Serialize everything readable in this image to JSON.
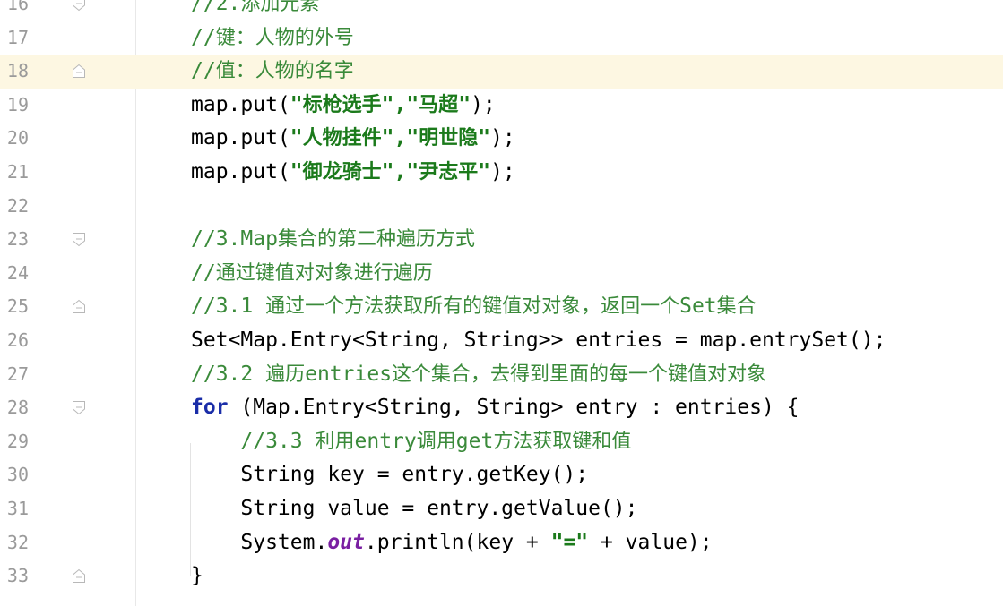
{
  "editor": {
    "current_line": 18,
    "lines": [
      {
        "num": "16",
        "fold": "open",
        "segments": [
          {
            "t": "//2.",
            "c": "cm"
          },
          {
            "t": "添加元素",
            "c": "cm-cn"
          }
        ]
      },
      {
        "num": "17",
        "fold": "none",
        "segments": [
          {
            "t": "//",
            "c": "cm"
          },
          {
            "t": "键：人物的外号",
            "c": "cm-cn"
          }
        ]
      },
      {
        "num": "18",
        "fold": "close",
        "segments": [
          {
            "t": "//",
            "c": "cm"
          },
          {
            "t": "值：人物的名字",
            "c": "cm-cn"
          }
        ]
      },
      {
        "num": "19",
        "fold": "none",
        "segments": [
          {
            "t": "map.put(",
            "c": ""
          },
          {
            "t": "\"",
            "c": "strq"
          },
          {
            "t": "标枪选手",
            "c": "str"
          },
          {
            "t": "\",\"",
            "c": "strq"
          },
          {
            "t": "马超",
            "c": "str"
          },
          {
            "t": "\"",
            "c": "strq"
          },
          {
            "t": ");",
            "c": ""
          }
        ]
      },
      {
        "num": "20",
        "fold": "none",
        "segments": [
          {
            "t": "map.put(",
            "c": ""
          },
          {
            "t": "\"",
            "c": "strq"
          },
          {
            "t": "人物挂件",
            "c": "str"
          },
          {
            "t": "\",\"",
            "c": "strq"
          },
          {
            "t": "明世隐",
            "c": "str"
          },
          {
            "t": "\"",
            "c": "strq"
          },
          {
            "t": ");",
            "c": ""
          }
        ]
      },
      {
        "num": "21",
        "fold": "none",
        "segments": [
          {
            "t": "map.put(",
            "c": ""
          },
          {
            "t": "\"",
            "c": "strq"
          },
          {
            "t": "御龙骑士",
            "c": "str"
          },
          {
            "t": "\",\"",
            "c": "strq"
          },
          {
            "t": "尹志平",
            "c": "str"
          },
          {
            "t": "\"",
            "c": "strq"
          },
          {
            "t": ");",
            "c": ""
          }
        ]
      },
      {
        "num": "22",
        "fold": "none",
        "segments": []
      },
      {
        "num": "23",
        "fold": "open",
        "segments": [
          {
            "t": "//3.Map",
            "c": "cm"
          },
          {
            "t": "集合的第二种遍历方式",
            "c": "cm-cn"
          }
        ]
      },
      {
        "num": "24",
        "fold": "none",
        "segments": [
          {
            "t": "//",
            "c": "cm"
          },
          {
            "t": "通过键值对对象进行遍历",
            "c": "cm-cn"
          }
        ]
      },
      {
        "num": "25",
        "fold": "close",
        "segments": [
          {
            "t": "//3.1 ",
            "c": "cm"
          },
          {
            "t": "通过一个方法获取所有的键值对对象，返回一个",
            "c": "cm-cn"
          },
          {
            "t": "Set",
            "c": "cm"
          },
          {
            "t": "集合",
            "c": "cm-cn"
          }
        ]
      },
      {
        "num": "26",
        "fold": "none",
        "segments": [
          {
            "t": "Set<Map.Entry<String, String>> entries = map.entrySet();",
            "c": ""
          }
        ]
      },
      {
        "num": "27",
        "fold": "none",
        "segments": [
          {
            "t": "//3.2 ",
            "c": "cm"
          },
          {
            "t": "遍历",
            "c": "cm-cn"
          },
          {
            "t": "entries",
            "c": "cm"
          },
          {
            "t": "这个集合，去得到里面的每一个键值对对象",
            "c": "cm-cn"
          }
        ]
      },
      {
        "num": "28",
        "fold": "open",
        "segments": [
          {
            "t": "for",
            "c": "kw"
          },
          {
            "t": " (Map.Entry<String, String> entry : entries) {",
            "c": ""
          }
        ]
      },
      {
        "num": "29",
        "fold": "none",
        "segments": [
          {
            "t": "    //3.3 ",
            "c": "cm"
          },
          {
            "t": "利用",
            "c": "cm-cn"
          },
          {
            "t": "entry",
            "c": "cm"
          },
          {
            "t": "调用",
            "c": "cm-cn"
          },
          {
            "t": "get",
            "c": "cm"
          },
          {
            "t": "方法获取键和值",
            "c": "cm-cn"
          }
        ]
      },
      {
        "num": "30",
        "fold": "none",
        "segments": [
          {
            "t": "    String key = entry.getKey();",
            "c": ""
          }
        ]
      },
      {
        "num": "31",
        "fold": "none",
        "segments": [
          {
            "t": "    String value = entry.getValue();",
            "c": ""
          }
        ]
      },
      {
        "num": "32",
        "fold": "none",
        "segments": [
          {
            "t": "    System.",
            "c": ""
          },
          {
            "t": "out",
            "c": "static"
          },
          {
            "t": ".println(key + ",
            "c": ""
          },
          {
            "t": "\"=\"",
            "c": "strq"
          },
          {
            "t": " + value);",
            "c": ""
          }
        ]
      },
      {
        "num": "33",
        "fold": "close",
        "segments": [
          {
            "t": "}",
            "c": ""
          }
        ]
      }
    ]
  }
}
